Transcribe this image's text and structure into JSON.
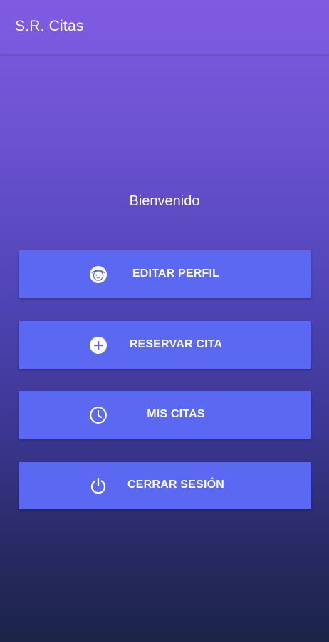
{
  "app_bar": {
    "title": "S.R. Citas"
  },
  "main": {
    "welcome_text": "Bienvenido",
    "buttons": [
      {
        "label": "EDITAR PERFIL",
        "icon": "face-icon"
      },
      {
        "label": "RESERVAR CITA",
        "icon": "add-circle-icon"
      },
      {
        "label": "MIS CITAS",
        "icon": "clock-icon"
      },
      {
        "label": "CERRAR SESIÓN",
        "icon": "power-icon"
      }
    ]
  },
  "colors": {
    "gradient_top": "#7f5be0",
    "gradient_bottom": "#1c2447",
    "button": "#5b68f2",
    "text": "#ffffff"
  }
}
